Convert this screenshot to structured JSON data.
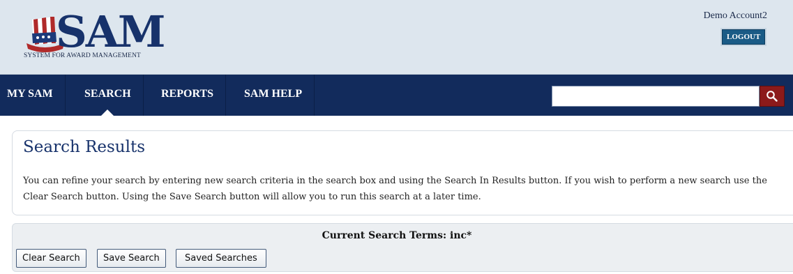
{
  "logo": {
    "text": "SAM",
    "subtitle": "SYSTEM FOR AWARD MANAGEMENT"
  },
  "account": {
    "name": "Demo Account2",
    "logout_label": "LOGOUT"
  },
  "nav": {
    "items": [
      {
        "label": "MY SAM",
        "active": false
      },
      {
        "label": "SEARCH",
        "active": true
      },
      {
        "label": "REPORTS",
        "active": false
      },
      {
        "label": "SAM HELP",
        "active": false
      }
    ],
    "search_value": "",
    "search_placeholder": ""
  },
  "results": {
    "title": "Search Results",
    "description": "You can refine your search by entering new search criteria in the search box and using the Search In Results button. If you wish to perform a new search use the Clear Search button. Using the Save Search button will allow you to run this search at a later time."
  },
  "terms": {
    "label": "Current Search Terms: inc*",
    "buttons": {
      "clear": "Clear Search",
      "save": "Save Search",
      "saved": "Saved Searches"
    }
  },
  "colors": {
    "nav_bg": "#122b5c",
    "header_bg": "#dde6ee",
    "search_btn": "#8c1a1a",
    "title": "#17326b"
  },
  "icons": {
    "search": "magnifier-icon",
    "logo": "uncle-sam-hat-icon"
  }
}
